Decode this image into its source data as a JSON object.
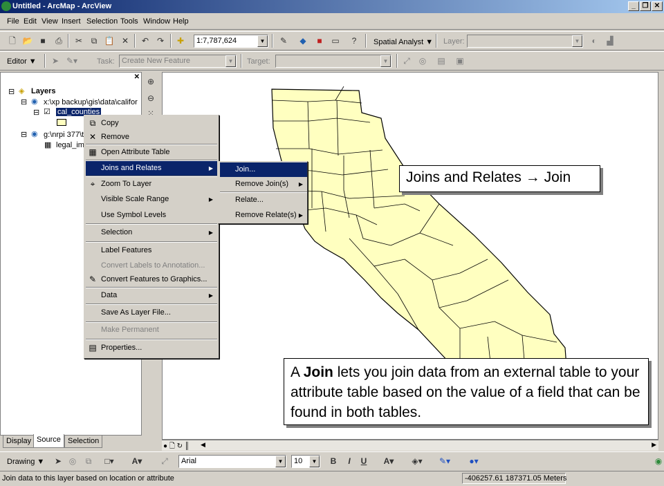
{
  "window": {
    "title": "Untitled - ArcMap - ArcView",
    "min": "_",
    "restore": "❐",
    "close": "✕"
  },
  "menubar": [
    "File",
    "Edit",
    "View",
    "Insert",
    "Selection",
    "Tools",
    "Window",
    "Help"
  ],
  "toolbar1": {
    "scale": "1:7,787,624",
    "spatial_analyst": "Spatial Analyst",
    "layer_label": "Layer:",
    "layer_value": ""
  },
  "toolbar2": {
    "editor": "Editor",
    "task_label": "Task:",
    "task_value": "Create New Feature",
    "target_label": "Target:",
    "target_value": ""
  },
  "toc": {
    "root": "Layers",
    "group1": "x:\\xp backup\\gis\\data\\califor",
    "layer1": "cal_counties",
    "group2": "g:\\nrpi 377\\t",
    "table2": "legal_imr",
    "tabs": [
      "Display",
      "Source",
      "Selection"
    ]
  },
  "context_menu": {
    "items": [
      "Copy",
      "Remove",
      "Open Attribute Table",
      "Joins and Relates",
      "Zoom To Layer",
      "Visible Scale Range",
      "Use Symbol Levels",
      "Selection",
      "Label Features",
      "Convert Labels to Annotation...",
      "Convert Features to Graphics...",
      "Data",
      "Save As Layer File...",
      "Make Permanent",
      "Properties..."
    ]
  },
  "submenu": {
    "items": [
      "Join...",
      "Remove Join(s)",
      "Relate...",
      "Remove Relate(s)"
    ]
  },
  "callout1": "Joins and Relates → Join",
  "callout2": {
    "pre": "A ",
    "bold": "Join",
    "post": " lets you join data from an external table to your attribute table based on the value of a field that can be found in both tables."
  },
  "drawbar": {
    "drawing": "Drawing",
    "font": "Arial",
    "size": "10",
    "bold": "B",
    "italic": "I",
    "underline": "U"
  },
  "status": {
    "message": "Join data to this layer based on location or attribute",
    "coords": "-406257.61  187371.05 Meters"
  },
  "colors": {
    "titlebar": "#0a246a",
    "county_fill": "#ffffc0",
    "highlight": "#0a246a"
  }
}
